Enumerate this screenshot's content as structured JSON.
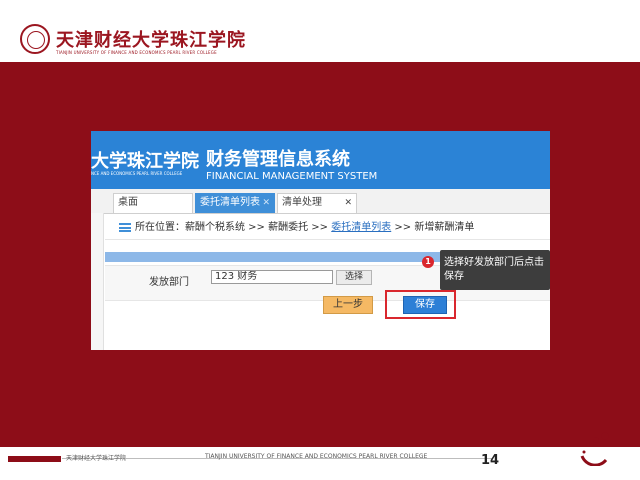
{
  "slide": {
    "university_cn": "天津财经大学珠江学院",
    "university_en": "TIANJIN UNIVERSITY OF FINANCE AND ECONOMICS PEARL RIVER COLLEGE",
    "page_number": "14",
    "footer_cn": "天津财经大学珠江学院",
    "footer_en": "TIANJIN UNIVERSITY OF FINANCE AND ECONOMICS PEARL RIVER COLLEGE"
  },
  "app": {
    "logo_cn": "大学珠江学院",
    "logo_en": "NCE AND ECONOMICS PEARL RIVER COLLEGE",
    "system_title": "财务管理信息系统",
    "system_subtitle": "FINANCIAL MANAGEMENT SYSTEM",
    "tabs": [
      {
        "label": "桌面",
        "active": false
      },
      {
        "label": "委托清单列表",
        "active": true
      },
      {
        "label": "清单处理",
        "active": false
      }
    ],
    "breadcrumb": {
      "prefix": "所在位置：",
      "part1": "薪酬个税系统 >> 薪酬委托 >> ",
      "link": "委托清单列表",
      "part2": " >> 新增薪酬清单"
    },
    "form": {
      "dept_label": "发放部门",
      "dept_value": "123 财务",
      "select_label": "选择"
    },
    "buttons": {
      "prev": "上一步",
      "save": "保存"
    },
    "tooltip": {
      "badge": "1",
      "text": "选择好发放部门后点击保存"
    }
  },
  "colors": {
    "brand_red": "#8d0d18",
    "header_blue": "#2b83d6",
    "highlight_red": "#d9272e"
  }
}
